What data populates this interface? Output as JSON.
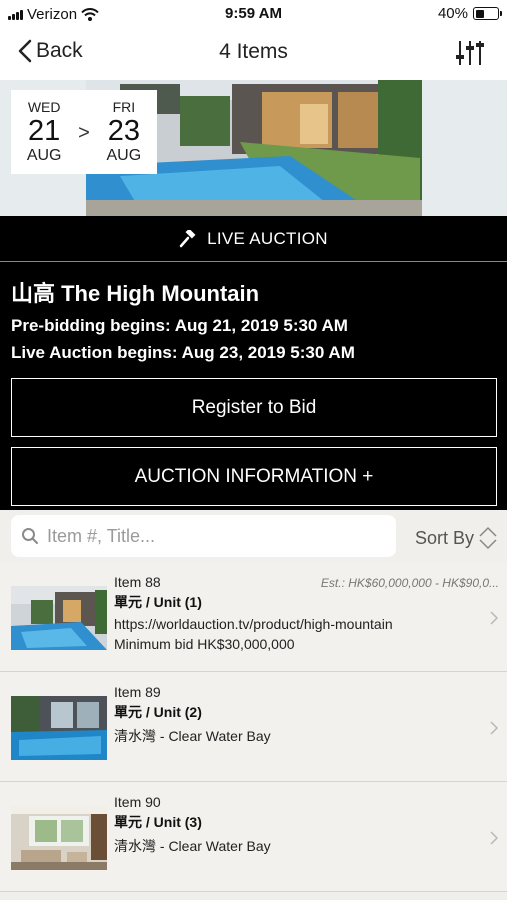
{
  "status_bar": {
    "carrier": "Verizon",
    "time": "9:59 AM",
    "battery": "40%",
    "battery_level": 0.4
  },
  "nav": {
    "back_label": "Back",
    "title": "4 Items",
    "filter_icon": "sliders-icon"
  },
  "dates": {
    "start": {
      "dow": "WED",
      "day": "21",
      "month": "AUG"
    },
    "separator": ">",
    "end": {
      "dow": "FRI",
      "day": "23",
      "month": "AUG"
    }
  },
  "auction": {
    "badge": "LIVE AUCTION",
    "title": "山高 The High Mountain",
    "prebid": "Pre-bidding begins: Aug 21, 2019 5:30 AM",
    "live": "Live Auction begins: Aug 23, 2019 5:30 AM",
    "register_label": "Register to Bid",
    "info_label": "AUCTION INFORMATION +"
  },
  "search": {
    "placeholder": "Item #, Title...",
    "value": "",
    "sort_label": "Sort By"
  },
  "items": [
    {
      "number": "Item 88",
      "unit": "單元 / Unit (1)",
      "location": "https://worldauction.tv/product/high-mountain",
      "min_bid": "Minimum bid HK$30,000,000",
      "estimate": "Est.: HK$60,000,000 - HK$90,0..."
    },
    {
      "number": "Item 89",
      "unit": "單元 / Unit (2)",
      "location": "清水灣 - Clear Water Bay"
    },
    {
      "number": "Item 90",
      "unit": "單元 / Unit (3)",
      "location": "清水灣 - Clear Water Bay"
    }
  ],
  "colors": {
    "panel": "#000000",
    "list_bg": "#f2f1ee",
    "muted": "#777777"
  }
}
